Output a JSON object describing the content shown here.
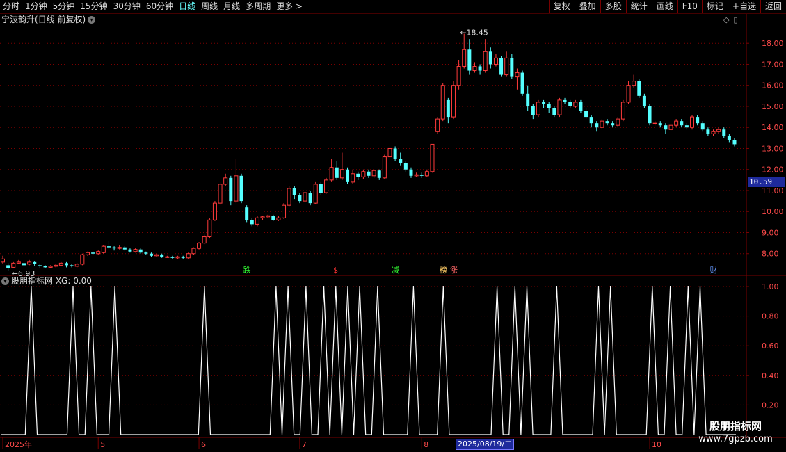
{
  "toolbar": {
    "periods": [
      "分时",
      "1分钟",
      "5分钟",
      "15分钟",
      "30分钟",
      "60分钟",
      "日线",
      "周线",
      "月线",
      "多周期",
      "更多 >"
    ],
    "active_period": "日线",
    "buttons": [
      "复权",
      "叠加",
      "多股",
      "统计",
      "画线",
      "F10",
      "标记",
      "+自选",
      "返回"
    ]
  },
  "chart_title": "宁波韵升(日线 前复权)",
  "indicator_title": "股朋指标网  XG: 0.00",
  "current_price_tag": "10.59",
  "date_tag": "2025/08/19/二",
  "watermark": {
    "line1": "股朋指标网",
    "line2": "www.7gpzb.com"
  },
  "colors": {
    "up": "#ff3b3b",
    "down": "#5ff",
    "grid": "#7a0000",
    "axis_text": "#ff4a4a",
    "xg_line": "#ffffff",
    "price_tag_bg": "#1e2a9c"
  },
  "chart_data": [
    {
      "type": "candlestick",
      "title": "宁波韵升(日线 前复权)",
      "y_ticks": [
        8.0,
        9.0,
        10.0,
        11.0,
        12.0,
        13.0,
        14.0,
        15.0,
        16.0,
        17.0,
        18.0
      ],
      "y_tick_labels": [
        "8.00",
        "9.00",
        "10.00",
        "11.00",
        "12.00",
        "13.00",
        "14.00",
        "15.00",
        "16.00",
        "17.00",
        "18.00"
      ],
      "ylim": [
        7.0,
        18.8
      ],
      "high_label": "18.45",
      "low_label": "6.93",
      "annotations": [
        {
          "text": "跌",
          "color": "#3f3"
        },
        {
          "text": "$",
          "color": "#f33"
        },
        {
          "text": "减",
          "color": "#3f3"
        },
        {
          "text": "榜",
          "color": "#fc6"
        },
        {
          "text": "涨",
          "color": "#f66"
        },
        {
          "text": "财",
          "color": "#69f"
        }
      ],
      "candles": [
        [
          7.6,
          7.75,
          7.5,
          7.9
        ],
        [
          7.45,
          7.3,
          7.2,
          7.55
        ],
        [
          7.35,
          7.55,
          7.3,
          7.6
        ],
        [
          7.55,
          7.6,
          7.5,
          7.7
        ],
        [
          7.55,
          7.45,
          7.4,
          7.6
        ],
        [
          7.5,
          7.6,
          7.45,
          7.7
        ],
        [
          7.6,
          7.5,
          7.4,
          7.65
        ],
        [
          7.45,
          7.4,
          7.3,
          7.5
        ],
        [
          7.4,
          7.35,
          7.3,
          7.45
        ],
        [
          7.35,
          7.4,
          7.3,
          7.45
        ],
        [
          7.4,
          7.45,
          7.35,
          7.5
        ],
        [
          7.45,
          7.55,
          7.4,
          7.6
        ],
        [
          7.55,
          7.45,
          7.35,
          7.6
        ],
        [
          7.45,
          7.4,
          7.35,
          7.5
        ],
        [
          7.4,
          7.5,
          7.35,
          7.55
        ],
        [
          7.5,
          7.95,
          7.45,
          8.0
        ],
        [
          7.95,
          8.05,
          7.9,
          8.1
        ],
        [
          8.05,
          8.0,
          7.95,
          8.1
        ],
        [
          8.0,
          8.1,
          7.95,
          8.15
        ],
        [
          8.05,
          8.35,
          8.0,
          8.4
        ],
        [
          8.35,
          8.3,
          8.2,
          8.6
        ],
        [
          8.3,
          8.25,
          8.15,
          8.35
        ],
        [
          8.25,
          8.3,
          8.2,
          8.4
        ],
        [
          8.3,
          8.2,
          8.15,
          8.35
        ],
        [
          8.2,
          8.1,
          8.05,
          8.25
        ],
        [
          8.1,
          8.2,
          8.05,
          8.25
        ],
        [
          8.2,
          8.05,
          8.0,
          8.25
        ],
        [
          8.05,
          8.0,
          7.95,
          8.1
        ],
        [
          8.0,
          7.9,
          7.85,
          8.05
        ],
        [
          7.9,
          7.95,
          7.85,
          8.0
        ],
        [
          7.95,
          7.85,
          7.8,
          8.0
        ],
        [
          7.85,
          7.85,
          7.8,
          7.9
        ],
        [
          7.85,
          7.8,
          7.75,
          7.9
        ],
        [
          7.8,
          7.85,
          7.75,
          7.9
        ],
        [
          7.85,
          7.8,
          7.75,
          7.9
        ],
        [
          7.8,
          8.0,
          7.75,
          8.05
        ],
        [
          8.0,
          8.25,
          7.95,
          8.3
        ],
        [
          8.25,
          8.5,
          8.2,
          8.55
        ],
        [
          8.5,
          8.8,
          8.45,
          8.9
        ],
        [
          8.8,
          9.6,
          8.75,
          9.7
        ],
        [
          9.6,
          10.4,
          9.55,
          10.5
        ],
        [
          10.4,
          11.3,
          10.3,
          11.4
        ],
        [
          11.3,
          11.6,
          11.2,
          11.8
        ],
        [
          11.6,
          10.5,
          10.3,
          11.7
        ],
        [
          10.5,
          11.7,
          10.4,
          12.5
        ],
        [
          11.7,
          10.5,
          10.4,
          11.8
        ],
        [
          10.2,
          9.6,
          9.5,
          10.3
        ],
        [
          9.6,
          9.4,
          9.3,
          9.7
        ],
        [
          9.4,
          9.7,
          9.3,
          9.8
        ],
        [
          9.7,
          9.75,
          9.6,
          9.8
        ],
        [
          9.75,
          9.8,
          9.7,
          9.85
        ],
        [
          9.8,
          9.6,
          9.55,
          9.85
        ],
        [
          9.6,
          9.7,
          9.55,
          9.8
        ],
        [
          9.7,
          10.3,
          9.65,
          10.4
        ],
        [
          10.3,
          11.1,
          10.25,
          11.2
        ],
        [
          11.1,
          10.8,
          10.6,
          11.2
        ],
        [
          10.8,
          10.5,
          10.4,
          10.9
        ],
        [
          10.5,
          10.9,
          10.45,
          11.0
        ],
        [
          10.9,
          10.4,
          10.3,
          11.0
        ],
        [
          10.4,
          11.3,
          10.35,
          11.4
        ],
        [
          11.3,
          10.9,
          10.8,
          11.4
        ],
        [
          10.9,
          11.5,
          10.85,
          11.6
        ],
        [
          11.5,
          12.1,
          11.4,
          12.5
        ],
        [
          12.1,
          11.6,
          11.5,
          12.4
        ],
        [
          11.6,
          12.0,
          11.5,
          12.8
        ],
        [
          12.0,
          11.4,
          11.3,
          12.1
        ],
        [
          11.4,
          11.8,
          11.3,
          12.0
        ],
        [
          11.8,
          11.65,
          11.5,
          11.9
        ],
        [
          11.65,
          11.9,
          11.55,
          12.0
        ],
        [
          11.9,
          11.7,
          11.6,
          12.0
        ],
        [
          11.7,
          11.95,
          11.6,
          12.0
        ],
        [
          11.95,
          11.6,
          11.5,
          12.0
        ],
        [
          11.6,
          12.6,
          11.55,
          12.7
        ],
        [
          12.6,
          13.0,
          12.5,
          13.1
        ],
        [
          13.0,
          12.5,
          12.4,
          13.1
        ],
        [
          12.5,
          12.3,
          12.2,
          12.8
        ],
        [
          12.3,
          12.0,
          11.9,
          12.4
        ],
        [
          12.0,
          11.7,
          11.6,
          12.1
        ],
        [
          11.7,
          11.75,
          11.65,
          11.85
        ],
        [
          11.75,
          11.7,
          11.6,
          11.85
        ],
        [
          11.7,
          11.9,
          11.65,
          12.0
        ],
        [
          11.9,
          13.2,
          11.85,
          13.2
        ],
        [
          13.8,
          14.4,
          13.7,
          14.5
        ],
        [
          14.4,
          16.0,
          14.3,
          16.1
        ],
        [
          15.3,
          14.5,
          14.2,
          15.4
        ],
        [
          14.5,
          16.0,
          14.4,
          16.2
        ],
        [
          16.0,
          16.9,
          15.8,
          17.2
        ],
        [
          16.9,
          17.7,
          16.8,
          18.45
        ],
        [
          17.7,
          16.7,
          16.5,
          18.2
        ],
        [
          16.7,
          16.9,
          16.6,
          17.1
        ],
        [
          16.9,
          16.7,
          16.5,
          17.0
        ],
        [
          16.7,
          17.6,
          16.6,
          18.2
        ],
        [
          17.6,
          17.0,
          16.8,
          17.8
        ],
        [
          17.0,
          17.3,
          16.9,
          17.5
        ],
        [
          17.3,
          16.5,
          16.4,
          17.4
        ],
        [
          16.5,
          17.3,
          16.4,
          17.6
        ],
        [
          17.3,
          16.4,
          16.3,
          17.5
        ],
        [
          16.4,
          16.6,
          15.8,
          16.8
        ],
        [
          16.6,
          15.6,
          15.5,
          16.7
        ],
        [
          15.6,
          15.0,
          14.8,
          16.0
        ],
        [
          15.0,
          14.6,
          14.4,
          15.1
        ],
        [
          14.6,
          15.2,
          14.5,
          15.3
        ],
        [
          15.2,
          15.1,
          14.9,
          15.3
        ],
        [
          15.1,
          14.9,
          14.7,
          15.2
        ],
        [
          14.9,
          14.6,
          14.5,
          15.0
        ],
        [
          14.6,
          15.3,
          14.5,
          15.4
        ],
        [
          15.3,
          15.2,
          15.1,
          15.4
        ],
        [
          15.2,
          15.0,
          14.9,
          15.3
        ],
        [
          15.0,
          15.2,
          14.9,
          15.3
        ],
        [
          15.2,
          14.8,
          14.7,
          15.3
        ],
        [
          14.8,
          14.5,
          14.4,
          14.9
        ],
        [
          14.5,
          14.2,
          14.0,
          14.6
        ],
        [
          14.2,
          14.0,
          13.8,
          14.3
        ],
        [
          14.0,
          14.3,
          13.9,
          14.4
        ],
        [
          14.3,
          14.2,
          14.1,
          14.4
        ],
        [
          14.2,
          14.1,
          14.0,
          14.3
        ],
        [
          14.1,
          14.4,
          14.0,
          14.5
        ],
        [
          14.4,
          15.2,
          14.3,
          15.3
        ],
        [
          15.2,
          16.0,
          15.1,
          16.2
        ],
        [
          16.0,
          16.2,
          15.9,
          16.5
        ],
        [
          16.2,
          15.5,
          15.4,
          16.3
        ],
        [
          15.5,
          15.0,
          14.9,
          15.6
        ],
        [
          15.0,
          14.2,
          14.1,
          15.1
        ],
        [
          14.2,
          14.2,
          14.1,
          14.3
        ],
        [
          14.2,
          14.1,
          14.0,
          14.3
        ],
        [
          14.1,
          13.9,
          13.7,
          14.2
        ],
        [
          13.9,
          14.1,
          13.8,
          14.2
        ],
        [
          14.1,
          14.3,
          14.0,
          14.4
        ],
        [
          14.3,
          14.1,
          14.0,
          14.4
        ],
        [
          14.1,
          14.0,
          13.9,
          14.2
        ],
        [
          14.0,
          14.5,
          13.9,
          14.6
        ],
        [
          14.5,
          14.2,
          14.1,
          14.6
        ],
        [
          14.2,
          13.9,
          13.8,
          14.3
        ],
        [
          13.9,
          13.7,
          13.6,
          14.0
        ],
        [
          13.7,
          13.8,
          13.6,
          13.9
        ],
        [
          13.8,
          13.9,
          13.7,
          14.0
        ],
        [
          13.9,
          13.6,
          13.5,
          14.0
        ],
        [
          13.6,
          13.4,
          13.3,
          13.7
        ],
        [
          13.4,
          13.2,
          13.1,
          13.5
        ]
      ]
    },
    {
      "type": "line",
      "title": "股朋指标网 XG",
      "series": [
        {
          "name": "XG",
          "values": [
            0,
            0,
            0,
            0,
            0,
            1,
            0,
            0,
            0,
            0,
            0,
            0,
            1,
            0,
            0,
            1,
            0,
            0,
            0,
            1,
            0,
            0,
            0,
            0,
            0,
            0,
            0,
            0,
            0,
            0,
            0,
            0,
            0,
            0,
            1,
            0,
            0,
            0,
            0,
            0,
            0,
            0,
            0,
            0,
            0,
            0,
            1,
            0,
            1,
            0,
            0,
            1,
            0,
            0,
            1,
            0,
            1,
            0,
            1,
            0,
            1,
            0,
            0,
            1,
            0,
            0,
            0,
            0,
            0,
            1,
            0,
            0,
            0,
            0,
            1,
            0,
            0,
            0,
            0,
            0,
            0,
            0,
            0,
            1,
            0,
            0,
            1,
            0,
            1,
            0,
            0,
            0,
            0,
            1,
            0,
            0,
            0,
            0,
            0,
            0,
            1,
            0,
            1,
            0,
            0,
            0,
            0,
            0,
            0,
            1,
            0,
            0,
            1,
            0,
            0,
            1,
            0,
            1,
            0,
            0,
            0,
            0,
            0,
            0
          ]
        }
      ],
      "y_ticks": [
        0.2,
        0.4,
        0.6,
        0.8,
        1.0
      ],
      "y_tick_labels": [
        "0.20",
        "0.40",
        "0.60",
        "0.80",
        "1.00"
      ],
      "ylim": [
        0,
        1.0
      ]
    }
  ],
  "x_axis_labels": [
    "2025年",
    "5",
    "6",
    "7",
    "8",
    "10"
  ]
}
